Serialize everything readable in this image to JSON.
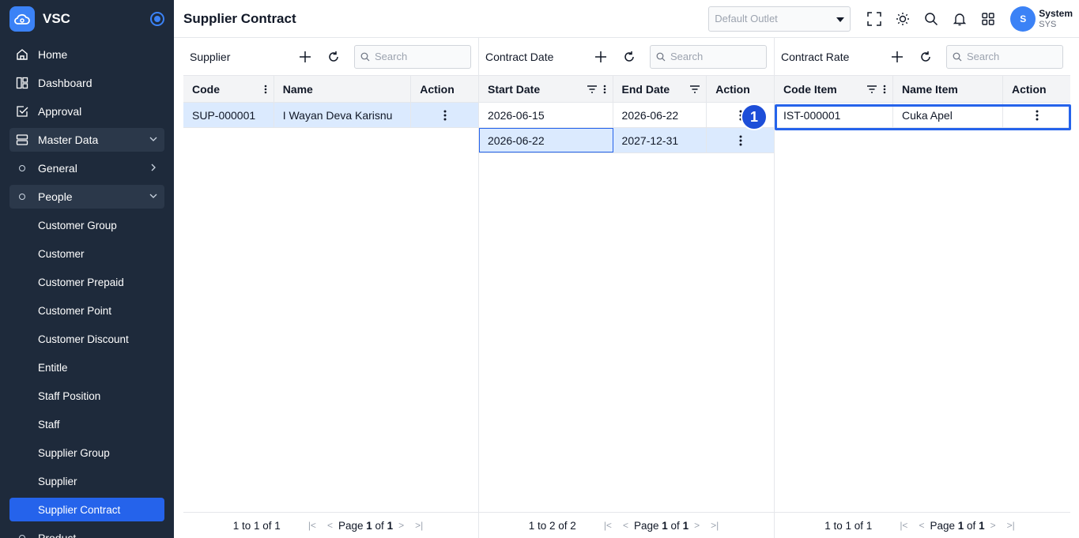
{
  "app": {
    "name": "VSC"
  },
  "sidebar": {
    "items": [
      {
        "label": "Home",
        "icon": "home-icon"
      },
      {
        "label": "Dashboard",
        "icon": "dashboard-icon"
      },
      {
        "label": "Approval",
        "icon": "approval-icon"
      },
      {
        "label": "Master Data",
        "icon": "database-icon"
      },
      {
        "label": "General"
      },
      {
        "label": "People"
      },
      {
        "label": "Customer Group"
      },
      {
        "label": "Customer"
      },
      {
        "label": "Customer Prepaid"
      },
      {
        "label": "Customer Point"
      },
      {
        "label": "Customer Discount"
      },
      {
        "label": "Entitle"
      },
      {
        "label": "Staff Position"
      },
      {
        "label": "Staff"
      },
      {
        "label": "Supplier Group"
      },
      {
        "label": "Supplier"
      },
      {
        "label": "Supplier Contract"
      },
      {
        "label": "Product"
      }
    ]
  },
  "header": {
    "title": "Supplier Contract",
    "outlet_placeholder": "Default Outlet",
    "user_name": "System",
    "user_code": "SYS",
    "avatar_initial": "S"
  },
  "supplier_panel": {
    "title": "Supplier",
    "search_placeholder": "Search",
    "columns": [
      "Code",
      "Name",
      "Action"
    ],
    "rows": [
      {
        "code": "SUP-000001",
        "name": "I Wayan Deva Karisnu"
      }
    ],
    "pager": {
      "range": "1 to 1 of 1",
      "page_label": "Page",
      "page": "1",
      "of_label": "of",
      "total": "1"
    }
  },
  "contract_date_panel": {
    "title": "Contract Date",
    "search_placeholder": "Search",
    "columns": [
      "Start Date",
      "End Date",
      "Action"
    ],
    "rows": [
      {
        "start": "2026-06-15",
        "end": "2026-06-22"
      },
      {
        "start": "2026-06-22",
        "end": "2027-12-31"
      }
    ],
    "pager": {
      "range": "1 to 2 of 2",
      "page_label": "Page",
      "page": "1",
      "of_label": "of",
      "total": "1"
    }
  },
  "contract_rate_panel": {
    "title": "Contract Rate",
    "search_placeholder": "Search",
    "columns": [
      "Code Item",
      "Name Item",
      "Action"
    ],
    "rows": [
      {
        "code": "IST-000001",
        "name": "Cuka Apel"
      }
    ],
    "pager": {
      "range": "1 to 1 of 1",
      "page_label": "Page",
      "page": "1",
      "of_label": "of",
      "total": "1"
    }
  },
  "annotation": {
    "badge": "1"
  },
  "colors": {
    "sidebar_bg": "#1e2a3b",
    "accent": "#2563eb",
    "selected_row": "#dbeafe"
  }
}
